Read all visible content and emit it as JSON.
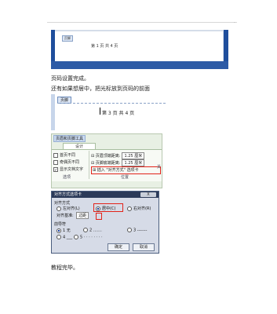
{
  "top_mark": ".",
  "screenshot1": {
    "header_tag": "页脚",
    "page_number_text": "第 1 页 共 4 页"
  },
  "paragraph1": "页码设置完成。",
  "paragraph2": "还有如果想居中，把光标放到页码的前面",
  "screenshot2": {
    "tab_label": "页脚",
    "page_number_text": "第 3 页 共 4 页"
  },
  "ribbon": {
    "tools_title": "页眉和页脚工具",
    "design_tab": "设计",
    "checkbox_first_page": "首页不同",
    "checkbox_odd_even": "奇偶页不同",
    "checkbox_show_text": "显示文档文字",
    "group_options": "选项",
    "header_top_label": "页眉顶端距离:",
    "header_top_value": "1.25 厘米",
    "footer_bottom_label": "页脚底端距离:",
    "footer_bottom_value": "1.25 厘米",
    "insert_align_tab": "插入 \"对齐方式\" 选项卡",
    "group_position": "位置",
    "side_mark": "关"
  },
  "dialog": {
    "title": "对齐方式选项卡",
    "close_button": "X",
    "align_section": "对齐方式",
    "align_left": "左对齐(L)",
    "align_center": "居中(C)",
    "align_right": "右对齐(R)",
    "align_base_label": "对齐基准:",
    "align_base_value": "边距",
    "leader_section": "前导符",
    "leader_none": "1 无",
    "leader_2": "2 .......",
    "leader_3": "3 -------",
    "leader_4": "4 ___",
    "leader_5": "5 · · · · · · · ·",
    "ok_button": "确定",
    "cancel_button": "取消"
  },
  "paragraph3": "教程完毕。"
}
